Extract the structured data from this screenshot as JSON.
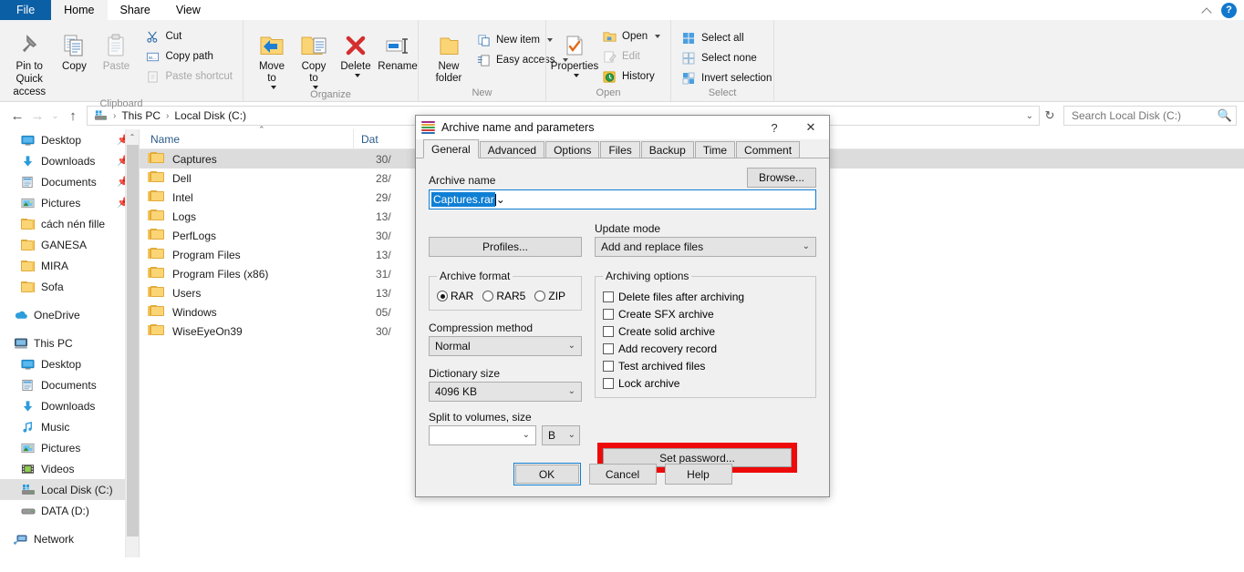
{
  "window": {
    "tabs": [
      {
        "label": "File",
        "state": "file"
      },
      {
        "label": "Home",
        "state": "active"
      },
      {
        "label": "Share",
        "state": "normal"
      },
      {
        "label": "View",
        "state": "normal"
      }
    ],
    "collapse_icon": "chevron-up-icon",
    "help_icon": "help-icon",
    "help_label": "?"
  },
  "ribbon": {
    "groups": [
      {
        "title": "Clipboard",
        "big": [
          {
            "label": "Pin to Quick\naccess",
            "icon": "pin-icon",
            "enabled": true
          },
          {
            "label": "Copy",
            "icon": "copy-icon",
            "enabled": true
          },
          {
            "label": "Paste",
            "icon": "paste-icon",
            "enabled": false
          }
        ],
        "small": [
          {
            "label": "Cut",
            "icon": "scissors-icon",
            "enabled": true
          },
          {
            "label": "Copy path",
            "icon": "copy-path-icon",
            "enabled": true
          },
          {
            "label": "Paste shortcut",
            "icon": "paste-shortcut-icon",
            "enabled": false
          }
        ]
      },
      {
        "title": "Organize",
        "big": [
          {
            "label": "Move\nto",
            "icon": "move-to-icon",
            "enabled": true,
            "dropdown": true
          },
          {
            "label": "Copy\nto",
            "icon": "copy-to-icon",
            "enabled": true,
            "dropdown": true
          },
          {
            "label": "Delete",
            "icon": "delete-icon",
            "enabled": true,
            "dropdown": true
          },
          {
            "label": "Rename",
            "icon": "rename-icon",
            "enabled": true
          }
        ],
        "small": []
      },
      {
        "title": "New",
        "big": [
          {
            "label": "New\nfolder",
            "icon": "new-folder-icon",
            "enabled": true
          }
        ],
        "small": [
          {
            "label": "New item",
            "icon": "new-item-icon",
            "enabled": true,
            "dropdown": true
          },
          {
            "label": "Easy access",
            "icon": "easy-access-icon",
            "enabled": true,
            "dropdown": true
          }
        ]
      },
      {
        "title": "Open",
        "big": [
          {
            "label": "Properties",
            "icon": "properties-icon",
            "enabled": true,
            "dropdown": true
          }
        ],
        "small": [
          {
            "label": "Open",
            "icon": "open-icon",
            "enabled": true,
            "dropdown": true
          },
          {
            "label": "Edit",
            "icon": "edit-icon",
            "enabled": false
          },
          {
            "label": "History",
            "icon": "history-icon",
            "enabled": true
          }
        ]
      },
      {
        "title": "Select",
        "big": [],
        "small": [
          {
            "label": "Select all",
            "icon": "select-all-icon",
            "enabled": true
          },
          {
            "label": "Select none",
            "icon": "select-none-icon",
            "enabled": true
          },
          {
            "label": "Invert selection",
            "icon": "invert-selection-icon",
            "enabled": true
          }
        ]
      }
    ]
  },
  "addressbar": {
    "back_icon": "arrow-left-icon",
    "forward_icon": "arrow-right-icon",
    "recent_icon": "chevron-down-icon",
    "up_icon": "arrow-up-icon",
    "path_icon": "local-disk-icon",
    "crumbs": [
      "This PC",
      "Local Disk (C:)"
    ],
    "separator": "›",
    "dropdown_icon": "chevron-down-icon",
    "refresh_icon": "refresh-icon",
    "refresh_glyph": "↻",
    "search_placeholder": "Search Local Disk (C:)",
    "search_value": "",
    "search_icon": "search-icon"
  },
  "navpane": {
    "quick_access": [
      {
        "label": "Desktop",
        "icon": "desktop-icon",
        "pinned": true,
        "indent": 1
      },
      {
        "label": "Downloads",
        "icon": "downloads-icon",
        "pinned": true,
        "indent": 1
      },
      {
        "label": "Documents",
        "icon": "documents-icon",
        "pinned": true,
        "indent": 1
      },
      {
        "label": "Pictures",
        "icon": "pictures-icon",
        "pinned": true,
        "indent": 1
      },
      {
        "label": "cách nén fille",
        "icon": "folder-icon",
        "pinned": false,
        "indent": 2
      },
      {
        "label": "GANESA",
        "icon": "folder-icon",
        "pinned": false,
        "indent": 2
      },
      {
        "label": "MIRA",
        "icon": "folder-icon",
        "pinned": false,
        "indent": 2
      },
      {
        "label": "Sofa",
        "icon": "folder-icon",
        "pinned": false,
        "indent": 2
      }
    ],
    "onedrive": {
      "label": "OneDrive",
      "icon": "onedrive-icon"
    },
    "thispc": {
      "label": "This PC",
      "icon": "computer-icon"
    },
    "thispc_children": [
      {
        "label": "Desktop",
        "icon": "desktop-icon",
        "selected": false
      },
      {
        "label": "Documents",
        "icon": "documents-icon",
        "selected": false
      },
      {
        "label": "Downloads",
        "icon": "downloads-icon",
        "selected": false
      },
      {
        "label": "Music",
        "icon": "music-icon",
        "selected": false
      },
      {
        "label": "Pictures",
        "icon": "pictures-icon",
        "selected": false
      },
      {
        "label": "Videos",
        "icon": "videos-icon",
        "selected": false
      },
      {
        "label": "Local Disk (C:)",
        "icon": "local-disk-icon",
        "selected": true
      },
      {
        "label": "DATA (D:)",
        "icon": "drive-icon",
        "selected": false
      }
    ],
    "network": {
      "label": "Network",
      "icon": "network-icon"
    },
    "scroll_up_glyph": "⌃"
  },
  "filelist": {
    "columns": [
      {
        "label": "Name",
        "sorted": true,
        "sort_glyph": "⌃"
      },
      {
        "label": "Dat"
      }
    ],
    "rows": [
      {
        "name": "Captures",
        "date": "30/",
        "icon": "folder-icon",
        "selected": true
      },
      {
        "name": "Dell",
        "date": "28/",
        "icon": "folder-icon",
        "selected": false
      },
      {
        "name": "Intel",
        "date": "29/",
        "icon": "folder-icon",
        "selected": false
      },
      {
        "name": "Logs",
        "date": "13/",
        "icon": "folder-icon",
        "selected": false
      },
      {
        "name": "PerfLogs",
        "date": "30/",
        "icon": "folder-icon",
        "selected": false
      },
      {
        "name": "Program Files",
        "date": "13/",
        "icon": "folder-icon",
        "selected": false
      },
      {
        "name": "Program Files (x86)",
        "date": "31/",
        "icon": "folder-icon",
        "selected": false
      },
      {
        "name": "Users",
        "date": "13/",
        "icon": "folder-icon",
        "selected": false
      },
      {
        "name": "Windows",
        "date": "05/",
        "icon": "folder-icon",
        "selected": false
      },
      {
        "name": "WiseEyeOn39",
        "date": "30/",
        "icon": "folder-icon",
        "selected": false
      }
    ]
  },
  "dialog": {
    "title": "Archive name and parameters",
    "app_icon": "winrar-icon",
    "help_glyph": "?",
    "close_glyph": "✕",
    "tabs": [
      {
        "label": "General",
        "active": true
      },
      {
        "label": "Advanced",
        "active": false
      },
      {
        "label": "Options",
        "active": false
      },
      {
        "label": "Files",
        "active": false
      },
      {
        "label": "Backup",
        "active": false
      },
      {
        "label": "Time",
        "active": false
      },
      {
        "label": "Comment",
        "active": false
      }
    ],
    "archive_name_label": "Archive name",
    "archive_name_value": "Captures.rar",
    "browse_label": "Browse...",
    "profiles_label": "Profiles...",
    "update_mode_label": "Update mode",
    "update_mode_value": "Add and replace files",
    "archive_format_label": "Archive format",
    "formats": [
      {
        "label": "RAR",
        "selected": true
      },
      {
        "label": "RAR5",
        "selected": false
      },
      {
        "label": "ZIP",
        "selected": false
      }
    ],
    "compression_label": "Compression method",
    "compression_value": "Normal",
    "dictionary_label": "Dictionary size",
    "dictionary_value": "4096 KB",
    "split_label": "Split to volumes, size",
    "split_value": "",
    "split_unit": "B",
    "archiving_options_label": "Archiving options",
    "options": [
      {
        "label": "Delete files after archiving",
        "checked": false
      },
      {
        "label": "Create SFX archive",
        "checked": false
      },
      {
        "label": "Create solid archive",
        "checked": false
      },
      {
        "label": "Add recovery record",
        "checked": false
      },
      {
        "label": "Test archived files",
        "checked": false
      },
      {
        "label": "Lock archive",
        "checked": false
      }
    ],
    "set_password_label": "Set password...",
    "set_password_highlight_color": "#ee0a0a",
    "ok_label": "OK",
    "cancel_label": "Cancel",
    "help_label": "Help",
    "focus_color": "#0f7fd4"
  }
}
